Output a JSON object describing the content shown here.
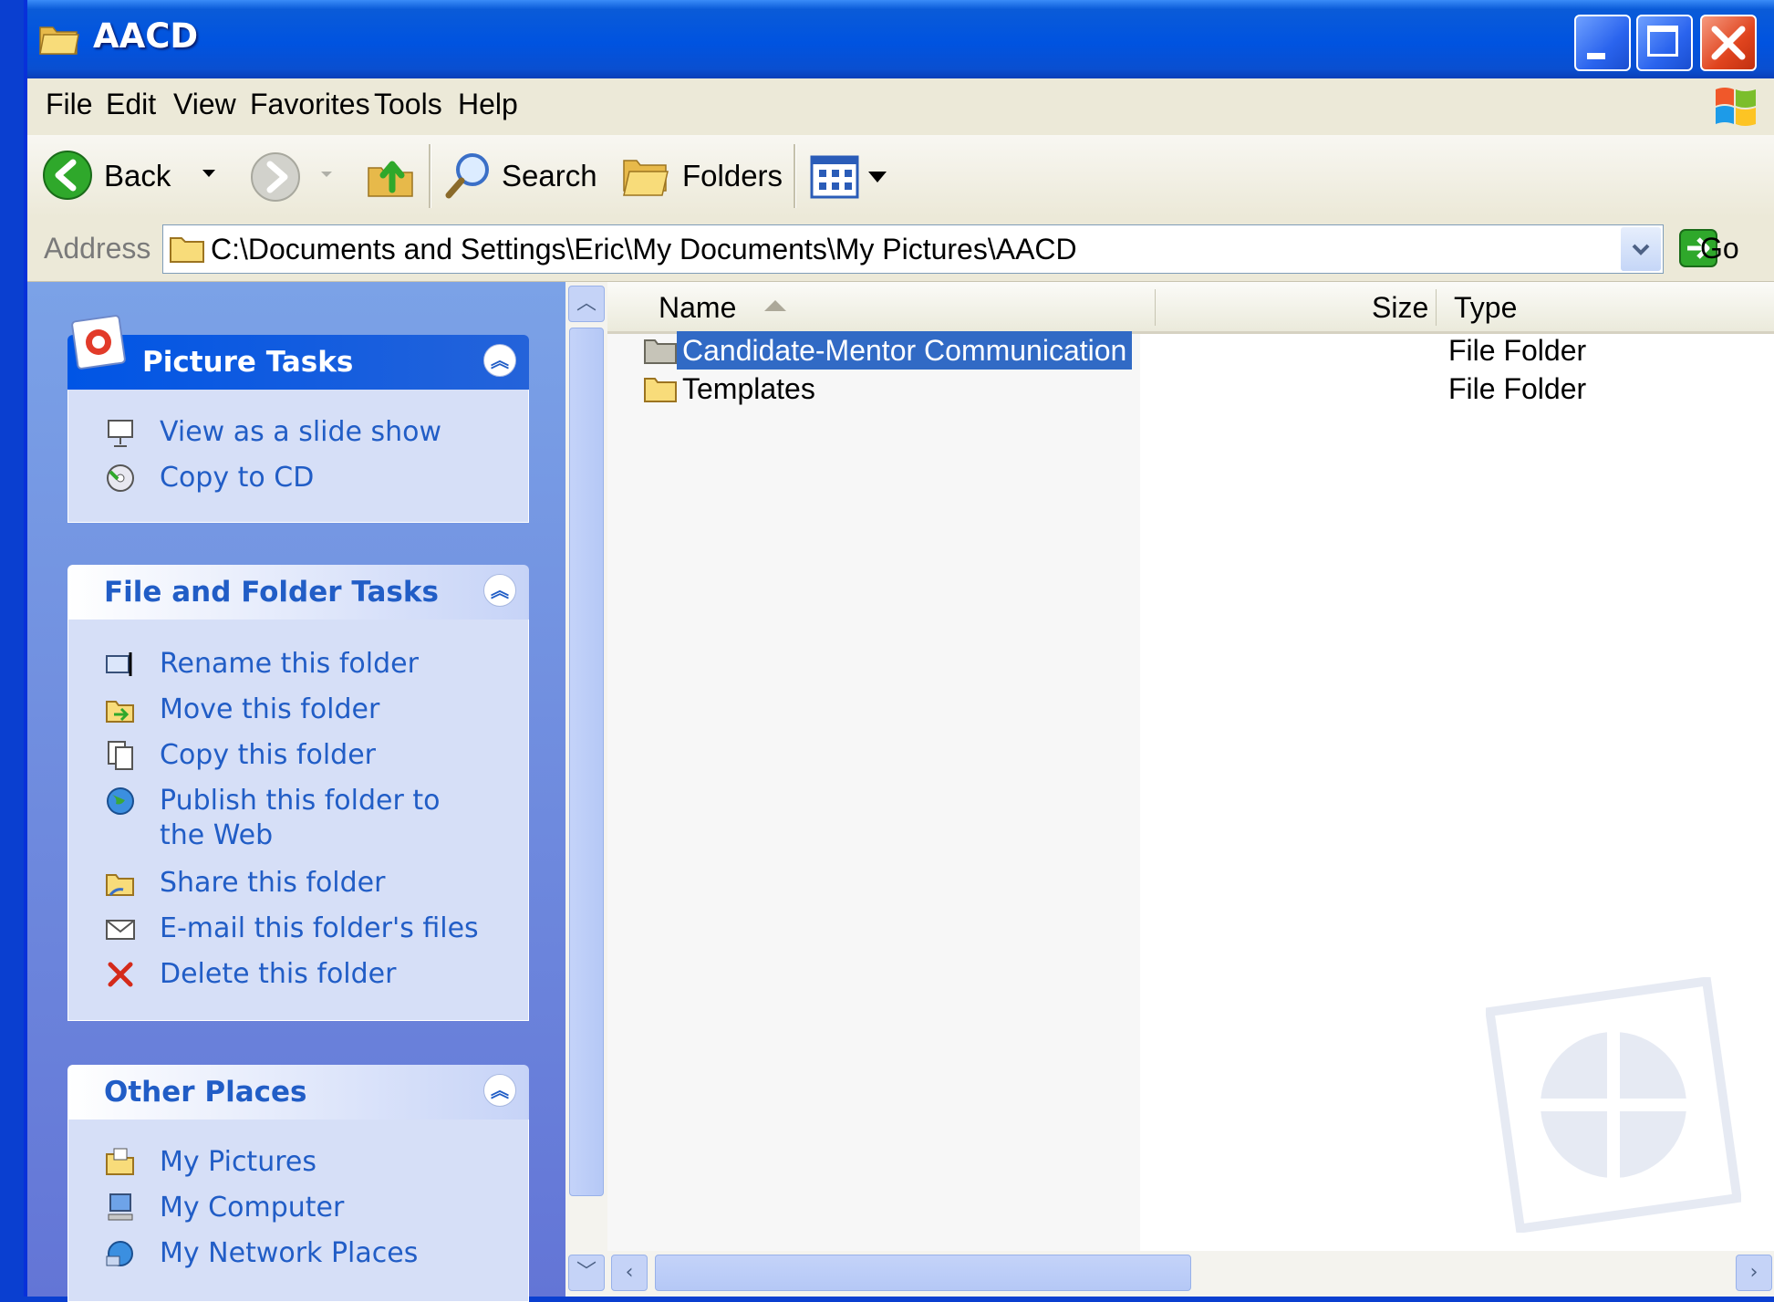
{
  "window": {
    "title": "AACD",
    "controls": [
      "minimize",
      "maximize",
      "close"
    ]
  },
  "menubar": {
    "items": [
      "File",
      "Edit",
      "View",
      "Favorites",
      "Tools",
      "Help"
    ]
  },
  "toolbar": {
    "back_label": "Back",
    "search_label": "Search",
    "folders_label": "Folders"
  },
  "address": {
    "label": "Address",
    "value": "C:\\Documents and Settings\\Eric\\My Documents\\My Pictures\\AACD",
    "go_label": "Go"
  },
  "taskpane": {
    "picture_tasks": {
      "title": "Picture Tasks",
      "items": [
        {
          "label": "View as a slide show",
          "icon": "slideshow-icon"
        },
        {
          "label": "Copy to CD",
          "icon": "cd-icon"
        }
      ]
    },
    "file_folder_tasks": {
      "title": "File and Folder Tasks",
      "items": [
        {
          "label": "Rename this folder",
          "icon": "rename-icon"
        },
        {
          "label": "Move this folder",
          "icon": "move-icon"
        },
        {
          "label": "Copy this folder",
          "icon": "copy-icon"
        },
        {
          "label": "Publish this folder to the Web",
          "icon": "globe-icon"
        },
        {
          "label": "Share this folder",
          "icon": "share-icon"
        },
        {
          "label": "E-mail this folder's files",
          "icon": "email-icon"
        },
        {
          "label": "Delete this folder",
          "icon": "delete-icon"
        }
      ]
    },
    "other_places": {
      "title": "Other Places",
      "items": [
        {
          "label": "My Pictures",
          "icon": "my-pictures-icon"
        },
        {
          "label": "My Computer",
          "icon": "my-computer-icon"
        },
        {
          "label": "My Network Places",
          "icon": "network-icon"
        }
      ]
    }
  },
  "filelist": {
    "columns": [
      "Name",
      "Size",
      "Type"
    ],
    "sorted_by": "Name",
    "rows": [
      {
        "name": "Candidate-Mentor Communication",
        "size": "",
        "type": "File Folder",
        "selected": true
      },
      {
        "name": "Templates",
        "size": "",
        "type": "File Folder",
        "selected": false
      }
    ]
  },
  "colors": {
    "titlebar": "#0053e0",
    "taskpane": "#7ba2e7",
    "link": "#215dc6",
    "selection": "#316ac5"
  }
}
